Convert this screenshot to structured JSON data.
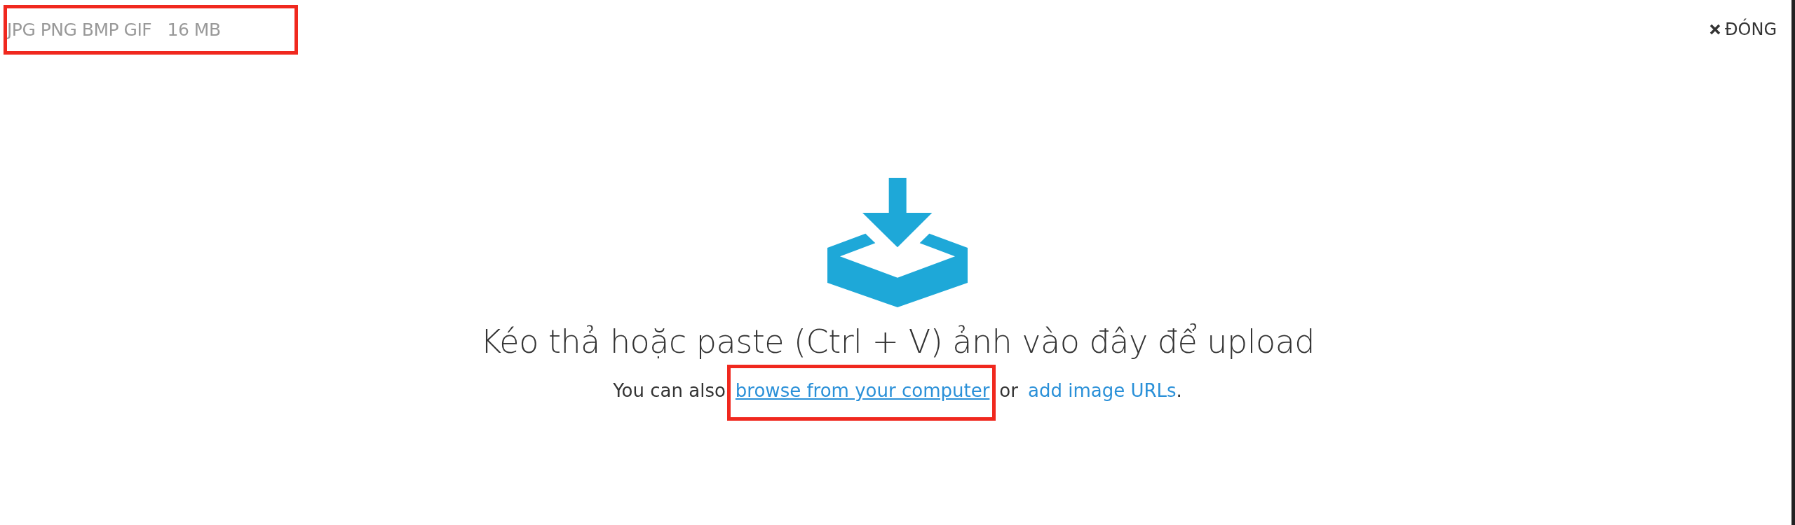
{
  "formats": {
    "text": "JPG PNG BMP GIF",
    "size": "16 MB",
    "highlighted": true
  },
  "close_button": {
    "label": "ĐÓNG"
  },
  "headline": "Kéo thả hoặc paste (Ctrl + V) ảnh vào đây để upload",
  "hint": {
    "before": "You can also",
    "link_browse": {
      "label": "browse from your computer",
      "highlighted": true
    },
    "middle": "or",
    "link_urls": {
      "label": "add image URLs"
    },
    "after": "."
  }
}
